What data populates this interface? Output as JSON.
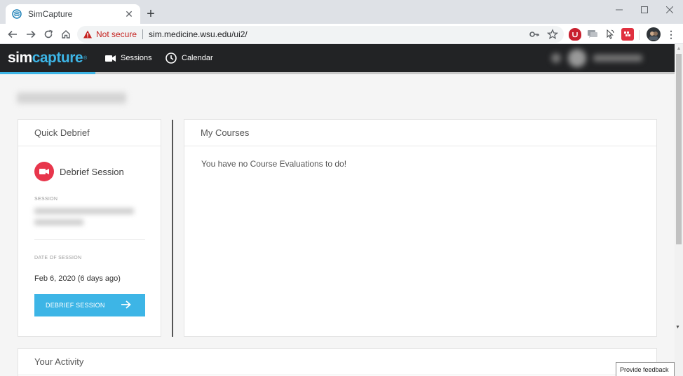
{
  "browser": {
    "tab": {
      "title": "SimCapture"
    },
    "address": {
      "security_label": "Not secure",
      "url": "sim.medicine.wsu.edu/ui2/"
    }
  },
  "app": {
    "brand": {
      "part1": "sim",
      "part2": "capture",
      "reg": "®"
    },
    "nav": [
      {
        "label": "Sessions",
        "icon": "video-camera-icon"
      },
      {
        "label": "Calendar",
        "icon": "clock-icon"
      }
    ]
  },
  "quick_debrief": {
    "title": "Quick Debrief",
    "heading": "Debrief Session",
    "session_label": "SESSION",
    "date_label": "DATE OF SESSION",
    "date_value": "Feb 6, 2020 (6 days ago)",
    "button_label": "DEBRIEF SESSION"
  },
  "my_courses": {
    "title": "My Courses",
    "empty_message": "You have no Course Evaluations to do!"
  },
  "your_activity": {
    "title": "Your Activity"
  },
  "feedback": {
    "label": "Provide feedback"
  },
  "colors": {
    "accent": "#3db5e6",
    "record": "#e8364c",
    "appbar": "#222325"
  }
}
